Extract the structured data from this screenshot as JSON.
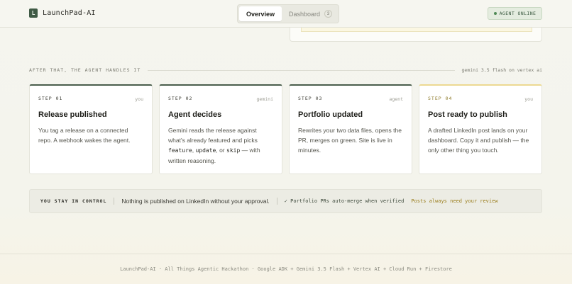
{
  "header": {
    "logo_letter": "L",
    "brand": "LaunchPad-AI",
    "tabs": [
      {
        "label": "Overview",
        "active": true
      },
      {
        "label": "Dashboard",
        "count": "3"
      }
    ],
    "status": "AGENT ONLINE"
  },
  "section": {
    "title": "AFTER THAT, THE AGENT HANDLES IT",
    "meta": "gemini 3.5 flash on vertex ai"
  },
  "steps": [
    {
      "step": "STEP 01",
      "actor": "you",
      "title": "Release published",
      "body": "You tag a release on a connected repo. A webhook wakes the agent."
    },
    {
      "step": "STEP 02",
      "actor": "gemini",
      "title": "Agent decides",
      "body_pre": "Gemini reads the release against what's already featured and picks ",
      "code_1": "feature",
      "sep_1": ", ",
      "code_2": "update",
      "sep_2": ", or ",
      "code_3": "skip",
      "body_post": " — with written reasoning."
    },
    {
      "step": "STEP 03",
      "actor": "agent",
      "title": "Portfolio updated",
      "body": "Rewrites your two data files, opens the PR, merges on green. Site is live in minutes."
    },
    {
      "step": "STEP 04",
      "actor": "you",
      "title": "Post ready to publish",
      "body": "A drafted LinkedIn post lands on your dashboard. Copy it and publish — the only other thing you touch."
    }
  ],
  "control": {
    "label": "YOU STAY IN CONTROL",
    "text": "Nothing is published on LinkedIn without your approval.",
    "ok": "✓ Portfolio PRs auto-merge when verified",
    "warn": "Posts always need your review"
  },
  "footer": {
    "text": "LaunchPad-AI · All Things Agentic Hackathon · Google ADK + Gemini 3.5 Flash + Vertex AI + Cloud Run + Firestore"
  },
  "colors": {
    "accent_green": "#3f5a45",
    "highlight_gold": "#ecd992",
    "status_bg": "#e4ecdf"
  }
}
